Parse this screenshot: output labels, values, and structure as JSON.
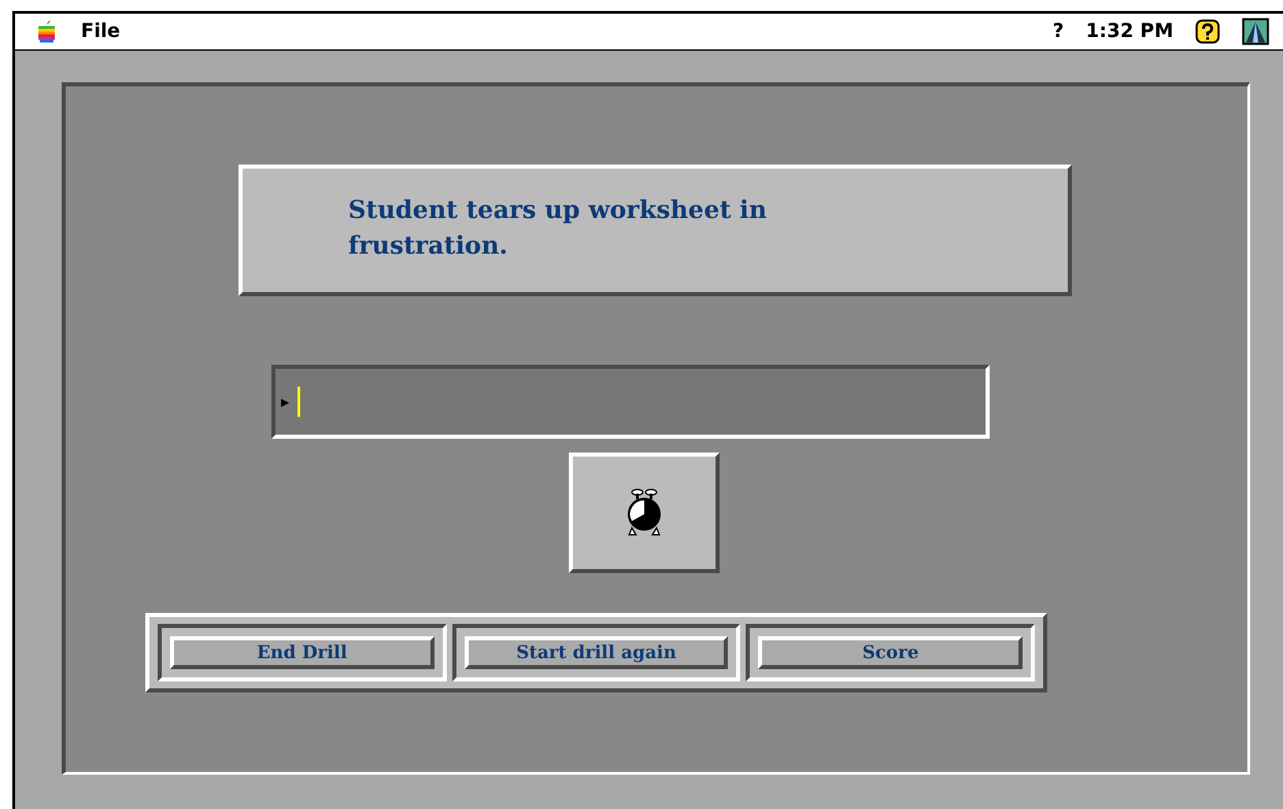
{
  "menu_bar": {
    "menus": [
      "File"
    ],
    "help_mark": "?",
    "clock": "1:32 PM"
  },
  "prompt": {
    "text": "Student tears up worksheet in frustration."
  },
  "answer_field": {
    "marker": "▸"
  },
  "buttons": [
    {
      "label": "End Drill"
    },
    {
      "label": "Start drill again"
    },
    {
      "label": "Score"
    }
  ]
}
